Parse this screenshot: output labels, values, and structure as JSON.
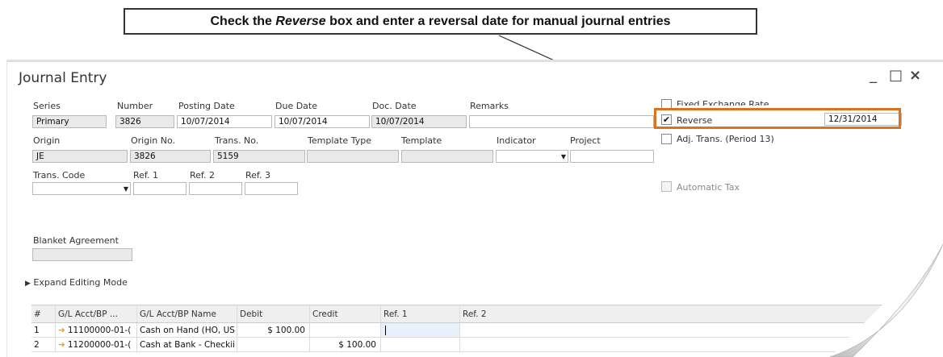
{
  "callout": {
    "pre": "Check the ",
    "em": "Reverse",
    "post": " box and enter a reversal date for manual journal entries"
  },
  "window": {
    "title": "Journal Entry",
    "min": "_",
    "max": "□",
    "close": "×"
  },
  "header": {
    "series_label": "Series",
    "series": "Primary",
    "number_label": "Number",
    "number": "3826",
    "posting_label": "Posting Date",
    "posting": "10/07/2014",
    "due_label": "Due Date",
    "due": "10/07/2014",
    "doc_label": "Doc. Date",
    "doc": "10/07/2014",
    "remarks_label": "Remarks",
    "remarks": "",
    "origin_label": "Origin",
    "origin": "JE",
    "originno_label": "Origin No.",
    "originno": "3826",
    "transno_label": "Trans. No.",
    "transno": "5159",
    "ttype_label": "Template Type",
    "template_label": "Template",
    "indicator_label": "Indicator",
    "project_label": "Project",
    "tcode_label": "Trans. Code",
    "ref1_label": "Ref. 1",
    "ref2_label": "Ref. 2",
    "ref3_label": "Ref. 3",
    "blanket_label": "Blanket Agreement"
  },
  "options": {
    "fixed_label": "Fixed Exchange Rate",
    "reverse_label": "Reverse",
    "reverse_checked": true,
    "reverse_date": "12/31/2014",
    "adj_label": "Adj. Trans. (Period 13)",
    "autotax_label": "Automatic Tax"
  },
  "expand_label": "Expand Editing Mode",
  "grid": {
    "headers": [
      "#",
      "G/L Acct/BP ...",
      "G/L Acct/BP Name",
      "Debit",
      "Credit",
      "Ref. 1",
      "Ref. 2"
    ],
    "rows": [
      {
        "n": "1",
        "acct": "11100000-01-(",
        "name": "Cash on Hand (HO, US",
        "debit": "$ 100.00",
        "credit": ""
      },
      {
        "n": "2",
        "acct": "11200000-01-(",
        "name": "Cash at Bank - Checkii",
        "debit": "",
        "credit": "$ 100.00"
      }
    ]
  }
}
